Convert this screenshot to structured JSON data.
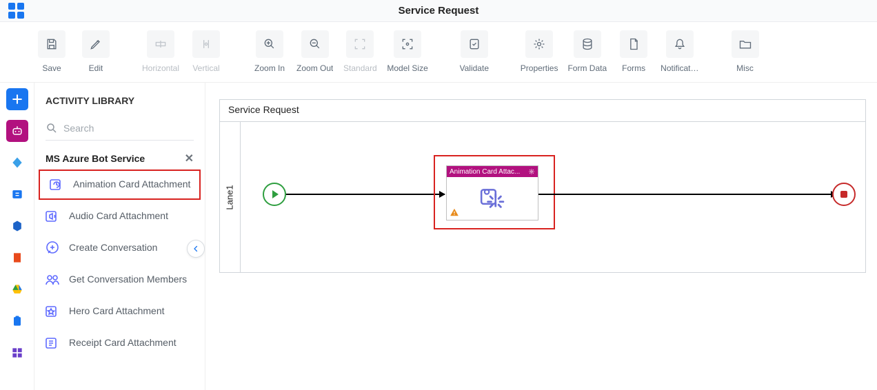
{
  "header": {
    "title": "Service Request"
  },
  "toolbar": {
    "save": "Save",
    "edit": "Edit",
    "horizontal": "Horizontal",
    "vertical": "Vertical",
    "zoom_in": "Zoom In",
    "zoom_out": "Zoom Out",
    "standard": "Standard",
    "model_size": "Model Size",
    "validate": "Validate",
    "properties": "Properties",
    "form_data": "Form Data",
    "forms": "Forms",
    "notifications": "Notificat…",
    "misc": "Misc"
  },
  "library": {
    "title": "ACTIVITY LIBRARY",
    "search_placeholder": "Search",
    "group": "MS Azure Bot Service",
    "items": [
      "Animation Card Attachment",
      "Audio Card Attachment",
      "Create Conversation",
      "Get Conversation Members",
      "Hero Card Attachment",
      "Receipt Card Attachment"
    ]
  },
  "canvas": {
    "title": "Service Request",
    "lane": "Lane1",
    "activity_title": "Animation Card Attac..."
  }
}
